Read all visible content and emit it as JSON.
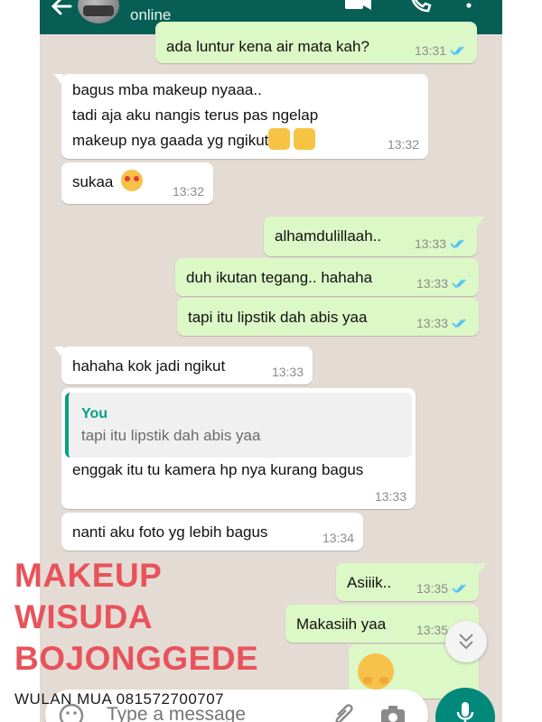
{
  "header": {
    "status": "online"
  },
  "colors": {
    "header_bg": "#075e54",
    "incoming_bubble": "#ffffff",
    "outgoing_bubble": "#dcf8c6",
    "read_ticks": "#4fc3f7",
    "overlay_text": "#e8535b"
  },
  "messages": [
    {
      "direction": "out",
      "lines": [
        "ada luntur kena air mata kah?"
      ],
      "time": "13:31",
      "read": true
    },
    {
      "direction": "in",
      "lines": [
        "bagus mba makeup nyaaa..",
        "tadi aja aku nangis terus pas ngelap",
        "makeup nya gaada yg ngikut"
      ],
      "emoji": [
        "thumbs-up",
        "thumbs-up"
      ],
      "time": "13:32"
    },
    {
      "direction": "in",
      "lines": [
        "sukaa"
      ],
      "emoji": [
        "heart-eyes"
      ],
      "time": "13:32"
    },
    {
      "direction": "out",
      "lines": [
        "alhamdulillaah.."
      ],
      "time": "13:33",
      "read": true
    },
    {
      "direction": "out",
      "lines": [
        "duh ikutan tegang.. hahaha"
      ],
      "time": "13:33",
      "read": true
    },
    {
      "direction": "out",
      "lines": [
        "tapi itu lipstik dah abis yaa"
      ],
      "time": "13:33",
      "read": true
    },
    {
      "direction": "in",
      "lines": [
        "hahaha kok jadi ngikut"
      ],
      "time": "13:33"
    },
    {
      "direction": "in",
      "quote": {
        "sender": "You",
        "text": "tapi itu lipstik dah abis yaa"
      },
      "lines": [
        "enggak itu tu kamera hp nya kurang bagus"
      ],
      "time": "13:33"
    },
    {
      "direction": "in",
      "lines": [
        "nanti aku foto yg lebih bagus"
      ],
      "time": "13:34"
    },
    {
      "direction": "out",
      "lines": [
        "Asiiik.."
      ],
      "time": "13:35",
      "read": true
    },
    {
      "direction": "out",
      "lines": [
        "Makasiih yaa"
      ],
      "time": "13:35",
      "read": true
    },
    {
      "direction": "out",
      "lines": [],
      "emoji": [
        "hugging-face"
      ]
    }
  ],
  "input": {
    "placeholder": "Type a message"
  },
  "overlay": {
    "title_lines": [
      "MAKEUP",
      "WISUDA",
      "BOJONGGEDE"
    ],
    "subtitle": "WULAN MUA 081572700707"
  }
}
